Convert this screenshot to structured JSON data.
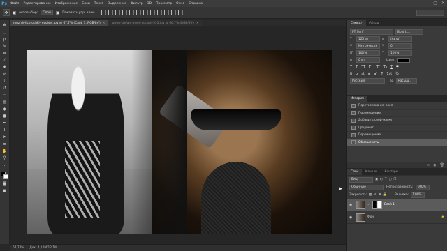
{
  "menubar": {
    "logo": "Ps",
    "items": [
      "Файл",
      "Редактирование",
      "Изображение",
      "Слои",
      "Текст",
      "Выделение",
      "Фильтр",
      "3D",
      "Просмотр",
      "Окно",
      "Справка"
    ],
    "window_controls": [
      "—",
      "▢",
      "✕"
    ]
  },
  "options": {
    "autoselect_label": "Автовыбор:",
    "autoselect_value": "Слой",
    "show_controls_label": "Показать упр. элем.",
    "workspace_value": ""
  },
  "tabs": [
    {
      "label": "muzhik-lico-ochki-revolver.jpg @ 67,7% (Слой 1, RGB/8#)",
      "active": true,
      "close": "×"
    },
    {
      "label": "gwen-stefani-gwen-stefani-555.jpg @ 66,7% (RGB/8#)",
      "active": false,
      "close": "×"
    }
  ],
  "status": {
    "zoom": "67,74%",
    "doc": "Док: 4,12М/12,1М"
  },
  "character": {
    "tabs": [
      "Символ",
      "Абзац"
    ],
    "font_family": "PT Serif",
    "font_style": "Bold It...",
    "font_size": "125 пт",
    "leading": "(Авто)",
    "kerning": "Метрически",
    "tracking": "0",
    "scale_v": "100%",
    "scale_h": "100%",
    "baseline": "0 пт",
    "color_label": "Цвет:",
    "language": "Русский",
    "aa_label": "aa",
    "aa_value": "Насыщ..."
  },
  "history": {
    "tab": "История",
    "items": [
      "Перетаскивание слоя",
      "Перемещение",
      "Добавить слой-маску",
      "Градиент",
      "Перемещение",
      "Обмещенить"
    ],
    "active_index": 5
  },
  "layers": {
    "tabs": [
      "Слои",
      "Каналы",
      "Контуры"
    ],
    "filter_label": "Вид",
    "blend_mode": "Обычные",
    "opacity_label": "Непрозрачность:",
    "opacity_value": "100%",
    "lock_label": "Закрепить:",
    "fill_label": "Заливка:",
    "fill_value": "100%",
    "items": [
      {
        "name": "Слой 1",
        "active": true
      },
      {
        "name": "Фон",
        "active": false
      }
    ]
  }
}
